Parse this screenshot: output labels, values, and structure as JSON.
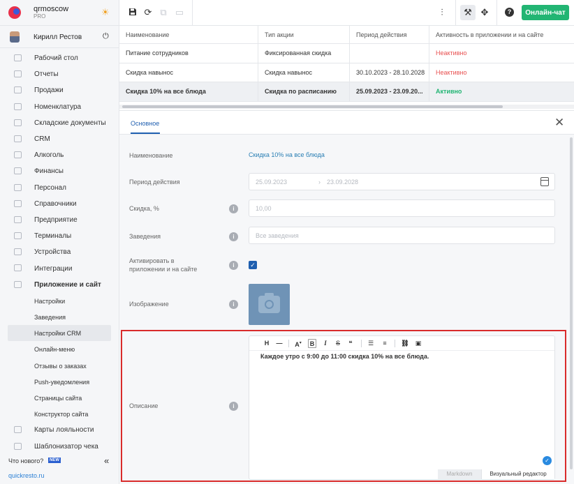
{
  "org": {
    "name": "qrmoscow",
    "plan": "PRO"
  },
  "user": {
    "name": "Кирилл Рестов"
  },
  "nav": [
    {
      "label": "Рабочий стол"
    },
    {
      "label": "Отчеты"
    },
    {
      "label": "Продажи"
    },
    {
      "label": "Номенклатура"
    },
    {
      "label": "Складские документы"
    },
    {
      "label": "CRM"
    },
    {
      "label": "Алкоголь"
    },
    {
      "label": "Финансы"
    },
    {
      "label": "Персонал"
    },
    {
      "label": "Справочники"
    },
    {
      "label": "Предприятие"
    },
    {
      "label": "Терминалы"
    },
    {
      "label": "Устройства"
    },
    {
      "label": "Интеграции"
    },
    {
      "label": "Приложение и сайт"
    }
  ],
  "subnav": [
    {
      "label": "Настройки"
    },
    {
      "label": "Заведения"
    },
    {
      "label": "Настройки CRM"
    },
    {
      "label": "Онлайн-меню"
    },
    {
      "label": "Отзывы о заказах"
    },
    {
      "label": "Push-уведомления"
    },
    {
      "label": "Страницы сайта"
    },
    {
      "label": "Конструктор сайта"
    }
  ],
  "nav_bottom": [
    {
      "label": "Карты лояльности"
    },
    {
      "label": "Шаблонизатор чека"
    }
  ],
  "footer": {
    "whats_new": "Что нового?",
    "badge": "NEW",
    "link": "quickresto.ru"
  },
  "topbar": {
    "chat_button": "Онлайн-чат"
  },
  "table": {
    "headers": [
      "Наименование",
      "Тип акции",
      "Период действия",
      "Активность в приложении и на сайте"
    ],
    "rows": [
      {
        "name": "Питание сотрудников",
        "type": "Фиксированная скидка",
        "period": "",
        "status": "Неактивно"
      },
      {
        "name": "Скидка навынос",
        "type": "Скидка навынос",
        "period": "30.10.2023 - 28.10.2028",
        "status": "Неактивно"
      },
      {
        "name": "Скидка 10% на все блюда",
        "type": "Скидка по расписанию",
        "period": "25.09.2023 - 23.09.20...",
        "status": "Активно"
      }
    ]
  },
  "panel": {
    "tab": "Основное",
    "fields": {
      "name_label": "Наименование",
      "name_value": "Скидка 10% на все блюда",
      "period_label": "Период действия",
      "period_from": "25.09.2023",
      "period_arrow": "›",
      "period_to": "23.09.2028",
      "discount_label": "Скидка, %",
      "discount_value": "10,00",
      "venues_label": "Заведения",
      "venues_placeholder": "Все заведения",
      "activate_label": "Активировать в приложении и на сайте",
      "activate_checked": true,
      "image_label": "Изображение",
      "description_label": "Описание"
    },
    "editor": {
      "text": "Каждое утро с 9:00 до 11:00 скидка 10% на все блюда.",
      "tab_markdown": "Markdown",
      "tab_visual": "Визуальный редактор"
    }
  },
  "colors": {
    "accent": "#1f5fb0",
    "success": "#22b573",
    "danger": "#e85050",
    "highlight": "#d92b2b"
  }
}
